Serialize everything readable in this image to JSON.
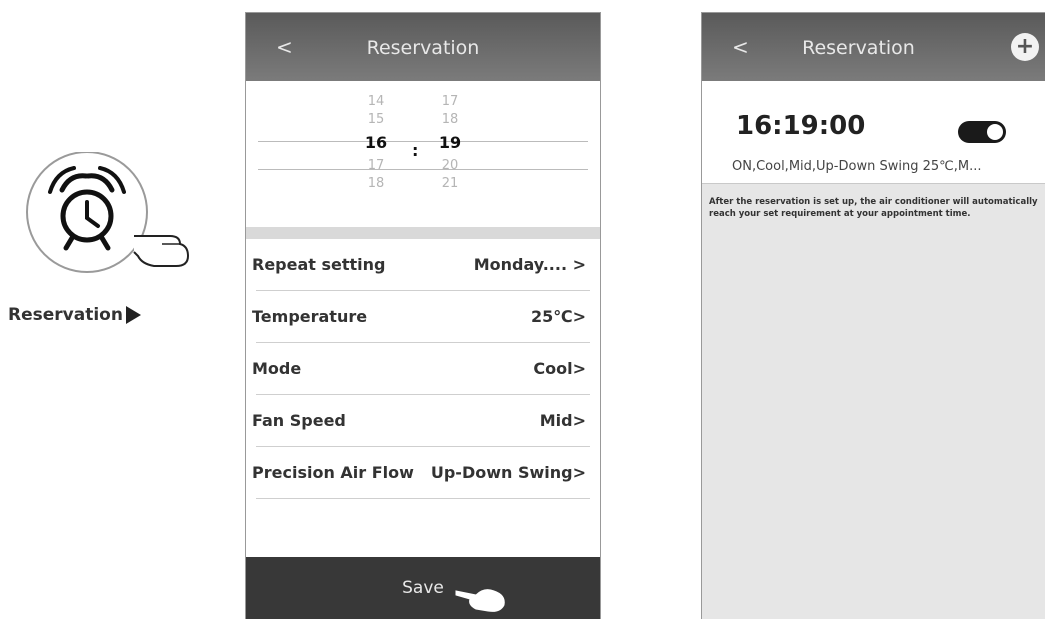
{
  "left": {
    "caption": "Reservation"
  },
  "screen1": {
    "back": "<",
    "title": "Reservation",
    "picker": {
      "hours": [
        "14",
        "15",
        "16",
        "17",
        "18"
      ],
      "minutes": [
        "17",
        "18",
        "19",
        "20",
        "21"
      ],
      "separator": ":"
    },
    "settings": [
      {
        "label": "Repeat setting",
        "value": "Monday.... >"
      },
      {
        "label": "Temperature",
        "value": "25℃>"
      },
      {
        "label": "Mode",
        "value": "Cool>"
      },
      {
        "label": "Fan Speed",
        "value": "Mid>"
      },
      {
        "label": "Precision Air Flow",
        "value": "Up-Down Swing>"
      }
    ],
    "save": "Save"
  },
  "screen2": {
    "back": "<",
    "title": "Reservation",
    "add": "+",
    "reservation": {
      "time": "16:19:00",
      "enabled": true,
      "summary": "ON,Cool,Mid,Up-Down Swing 25℃,M..."
    },
    "note": "After the reservation is set up, the air conditioner will automatically reach your set requirement at your appointment time."
  },
  "colors": {
    "header": "#6a6a6a",
    "save_bar": "#383838",
    "toggle_on": "#1a1a1a",
    "list_bg": "#e6e6e6"
  },
  "icons": [
    "alarm-clock-icon",
    "pointing-hand-icon",
    "play-triangle-icon",
    "plus-icon",
    "toggle-switch-icon"
  ]
}
